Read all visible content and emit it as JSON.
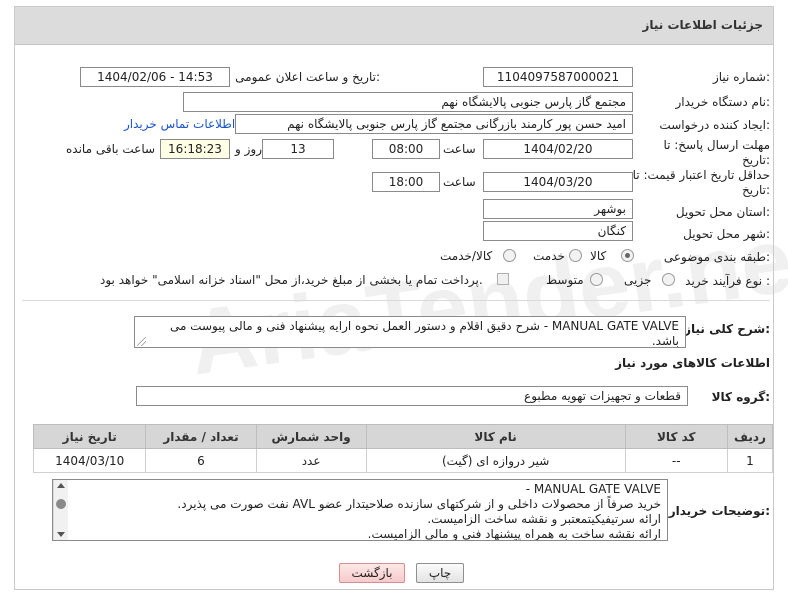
{
  "header": {
    "title": "جزئیات اطلاعات نیاز"
  },
  "fields": {
    "need_number_label": "شماره نیاز:",
    "need_number": "1104097587000021",
    "announce_label": "تاریخ و ساعت اعلان عمومی:",
    "announce_value": "1404/02/06 - 14:53",
    "buyer_org_label": "نام دستگاه خریدار:",
    "buyer_org": "مجتمع گاز پارس جنوبی  پالایشگاه نهم",
    "creator_label": "ایجاد کننده درخواست:",
    "creator": "امید حسن پور کارمند بازرگانی مجتمع گاز پارس جنوبی  پالایشگاه نهم",
    "buyer_contact_link": "اطلاعات تماس خریدار",
    "deadline_label": "مهلت ارسال پاسخ: تا تاریخ:",
    "deadline_date": "1404/02/20",
    "time_label": "ساعت",
    "deadline_time": "08:00",
    "days_value": "13",
    "days_label": "روز و",
    "remaining_time": "16:18:23",
    "remaining_label": "ساعت باقی مانده",
    "validity_label": "حداقل تاریخ اعتبار قیمت: تا تاریخ:",
    "validity_date": "1404/03/20",
    "validity_time": "18:00",
    "province_label": "استان محل تحویل:",
    "province": "بوشهر",
    "city_label": "شهر محل تحویل:",
    "city": "کنگان",
    "category_label": "طبقه بندی موضوعی:",
    "category_options": [
      "کالا",
      "خدمت",
      "کالا/خدمت"
    ],
    "category_selected": "کالا",
    "process_label": "نوع فرآیند خرید :",
    "process_options": [
      "جزیی",
      "متوسط"
    ],
    "payment_note": "پرداخت تمام یا بخشی از مبلغ خرید،از محل \"اسناد خزانه اسلامی\" خواهد بود."
  },
  "description": {
    "label": "شرح کلی نیاز:",
    "text": "MANUAL GATE VALVE - شرح دقیق اقلام و دستور العمل نحوه ارایه پیشنهاد فنی و مالی پیوست می باشد."
  },
  "goods": {
    "section_title": "اطلاعات کالاهای مورد نیاز",
    "group_label": "گروه کالا:",
    "group_value": "قطعات و تجهیزات تهویه مطبوع",
    "columns": [
      "ردیف",
      "کد کالا",
      "نام کالا",
      "واحد شمارش",
      "تعداد / مقدار",
      "تاریخ نیاز"
    ],
    "rows": [
      {
        "row": "1",
        "code": "--",
        "name": "شیر دروازه ای (گیت)",
        "unit": "عدد",
        "qty": "6",
        "date": "1404/03/10"
      }
    ]
  },
  "buyer_notes": {
    "label": "توضیحات خریدار:",
    "lines": [
      "MANUAL GATE VALVE -",
      "خرید صرفاً از محصولات داخلی و از شرکتهای سازنده صلاحیتدار عضو AVL نفت صورت می پذیرد.",
      "ارائه سرتیفیکیتمعتبر و نقشه ساخت الزامیست.",
      "ارائه نقشه ساخت به همراه پیشنهاد فنی و مالی الزامیست."
    ]
  },
  "buttons": {
    "print": "چاپ",
    "back": "بازگشت"
  },
  "colors": {
    "link": "#1a56c9",
    "header_bg": "#dcdcdc",
    "back_button": "#f7caca"
  }
}
